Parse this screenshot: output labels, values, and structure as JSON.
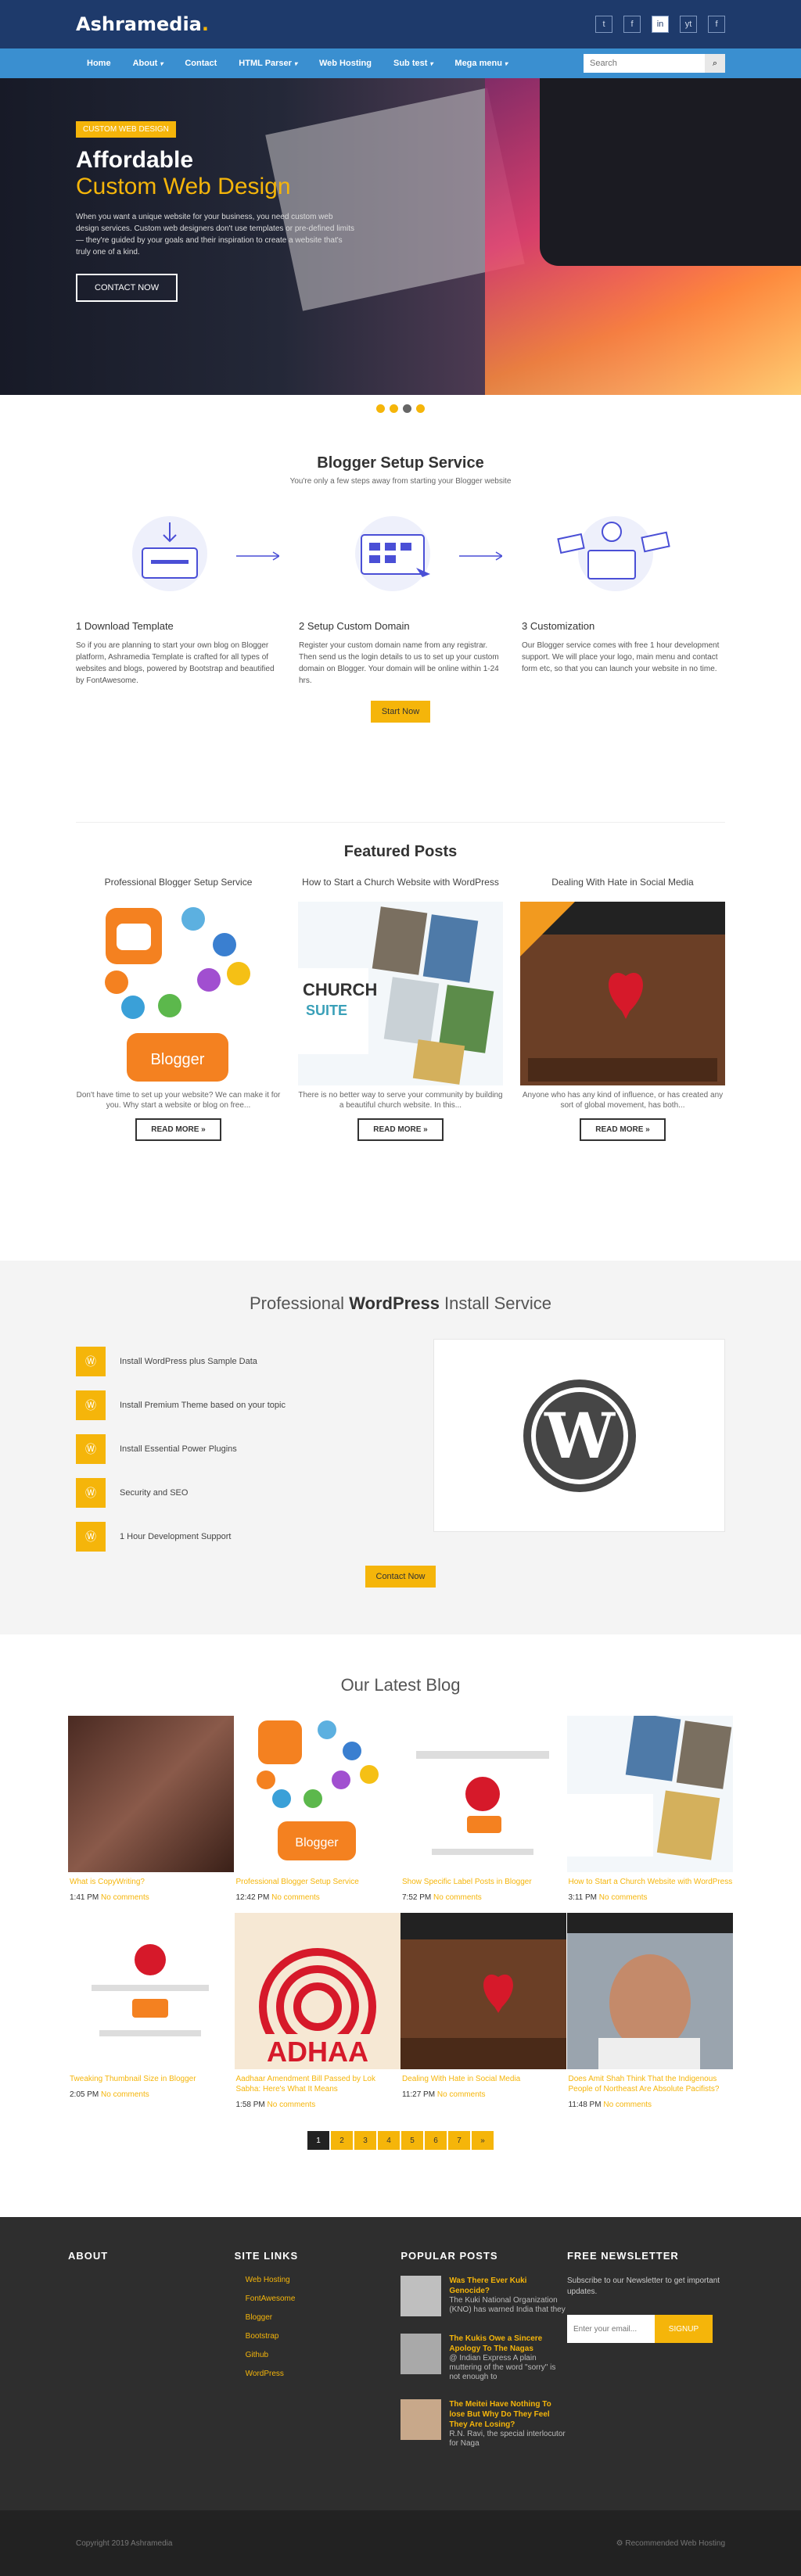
{
  "header": {
    "logo": "Ashramedia",
    "social": [
      "t",
      "f",
      "in",
      "yt",
      "f"
    ]
  },
  "nav": {
    "items": [
      "Home",
      "About",
      "Contact",
      "HTML Parser",
      "Web Hosting",
      "Sub test",
      "Mega menu"
    ],
    "search_placeholder": "Search",
    "search_btn": "⌕"
  },
  "hero": {
    "tag": "CUSTOM WEB DESIGN",
    "title": "Affordable",
    "title2": "Custom Web Design",
    "text": "When you want a unique website for your business, you need custom web design services. Custom web designers don't use templates or pre-defined limits — they're guided by your goals and their inspiration to create a website that's truly one of a kind.",
    "cta": "CONTACT NOW"
  },
  "setup": {
    "title": "Blogger Setup Service",
    "subtitle": "You're only a few steps away from starting your Blogger website",
    "steps": [
      {
        "title": "1  Download Template",
        "text": "So if you are planning to start your own blog on Blogger platform, Ashramedia Template is crafted for all types of websites and blogs, powered by Bootstrap and beautified by FontAwesome."
      },
      {
        "title": "2  Setup Custom Domain",
        "text": "Register your custom domain name from any registrar. Then send us the login details to us to set up your custom domain on Blogger. Your domain will be online within 1-24 hrs."
      },
      {
        "title": "3  Customization",
        "text": "Our Blogger service comes with free 1 hour development support. We will place your logo, main menu and contact form etc, so that you can launch your website in no time."
      }
    ],
    "cta": "Start Now"
  },
  "featured": {
    "title": "Featured Posts",
    "posts": [
      {
        "title": "Professional Blogger Setup Service",
        "text": "Don't have time to set up your website? We can make it for you. Why start a website or blog on free...",
        "btn": "READ MORE »"
      },
      {
        "title": "How to Start a Church Website with WordPress",
        "text": "There is no better way to serve your community by building a beautiful church website. In this...",
        "btn": "READ MORE »"
      },
      {
        "title": "Dealing With Hate in Social Media",
        "text": "Anyone who has any kind of influence, or has created any sort of global movement, has both...",
        "btn": "READ MORE »"
      }
    ]
  },
  "wordpress": {
    "title_a": "Professional ",
    "title_b": "WordPress",
    "title_c": " Install Service",
    "items": [
      "Install WordPress plus Sample Data",
      "Install Premium Theme based on your topic",
      "Install Essential Power Plugins",
      "Security and SEO",
      "1 Hour Development Support"
    ],
    "cta": "Contact Now"
  },
  "blog": {
    "title": "Our Latest Blog",
    "posts": [
      {
        "title": "What is CopyWriting?",
        "time": "1:41 PM",
        "comments": "No comments"
      },
      {
        "title": "Professional Blogger Setup Service",
        "time": "12:42 PM",
        "comments": "No comments"
      },
      {
        "title": "Show Specific Label Posts in Blogger",
        "time": "7:52 PM",
        "comments": "No comments"
      },
      {
        "title": "How to Start a Church Website with WordPress",
        "time": "3:11 PM",
        "comments": "No comments"
      },
      {
        "title": "Tweaking Thumbnail Size in Blogger",
        "time": "2:05 PM",
        "comments": "No comments"
      },
      {
        "title": "Aadhaar Amendment Bill Passed by Lok Sabha: Here's What It Means",
        "time": "1:58 PM",
        "comments": "No comments"
      },
      {
        "title": "Dealing With Hate in Social Media",
        "time": "11:27 PM",
        "comments": "No comments"
      },
      {
        "title": "Does Amit Shah Think That the Indigenous People of Northeast Are Absolute Pacifists?",
        "time": "11:48 PM",
        "comments": "No comments"
      }
    ],
    "pages": [
      "1",
      "2",
      "3",
      "4",
      "5",
      "6",
      "7",
      "»"
    ]
  },
  "footer": {
    "about": "ABOUT",
    "sitelinks": "SITE LINKS",
    "links": [
      "Web Hosting",
      "FontAwesome",
      "Blogger",
      "Bootstrap",
      "Github",
      "WordPress"
    ],
    "popular": "POPULAR POSTS",
    "pop": [
      {
        "t": "Was There Ever Kuki Genocide?",
        "d": "The Kuki National Organization (KNO) has warned India that they"
      },
      {
        "t": "The Kukis Owe a Sincere Apology To The Nagas",
        "d": "@ Indian Express A plain muttering of the word \"sorry\" is not enough to"
      },
      {
        "t": "The Meitei Have Nothing To lose But Why Do They Feel They Are Losing?",
        "d": "R.N. Ravi, the special interlocutor for Naga"
      }
    ],
    "newsletter": "FREE NEWSLETTER",
    "nl_text": "Subscribe to our Newsletter to get important updates.",
    "nl_placeholder": "Enter your email...",
    "nl_btn": "SIGNUP",
    "copyright": "Copyright 2019 Ashramedia",
    "recommended": "Recommended Web Hosting"
  }
}
